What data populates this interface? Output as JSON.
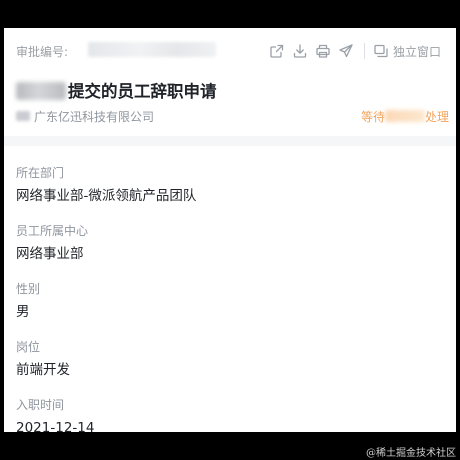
{
  "header": {
    "approval_label": "审批编号:",
    "popout_label": "独立窗口"
  },
  "icons": {
    "share": "share-icon",
    "download": "download-icon",
    "print": "print-icon",
    "send": "send-icon",
    "popout": "popout-window-icon"
  },
  "request": {
    "title": "提交的员工辞职申请",
    "company": "广东亿迅科技有限公司",
    "status_prefix": "等待",
    "status_suffix": "处理"
  },
  "fields": [
    {
      "label": "所在部门",
      "value": "网络事业部-微派领航产品团队"
    },
    {
      "label": "员工所属中心",
      "value": "网络事业部"
    },
    {
      "label": "性别",
      "value": "男"
    },
    {
      "label": "岗位",
      "value": "前端开发"
    },
    {
      "label": "入职时间",
      "value": "2021-12-14"
    }
  ],
  "watermark": "@稀土掘金技术社区",
  "colors": {
    "status": "#f5a35b",
    "text_primary": "#1f2329",
    "text_secondary": "#8f959e",
    "icon": "#9aa0a6"
  }
}
